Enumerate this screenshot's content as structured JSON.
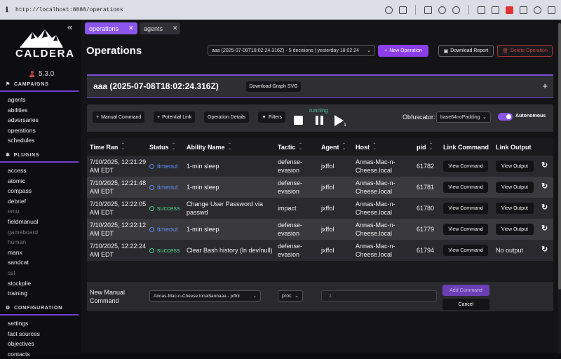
{
  "browser": {
    "url": "http://localhost:8888/operations"
  },
  "sidebar": {
    "brand": "CALDERA",
    "version": "5.3.0",
    "campaigns_header": "CAMPAIGNS",
    "campaigns": [
      "agents",
      "abilities",
      "adversaries",
      "operations",
      "schedules"
    ],
    "plugins_header": "PLUGINS",
    "plugins": [
      {
        "label": "access",
        "enabled": true
      },
      {
        "label": "atomic",
        "enabled": true
      },
      {
        "label": "compass",
        "enabled": true
      },
      {
        "label": "debrief",
        "enabled": true
      },
      {
        "label": "emu",
        "enabled": false
      },
      {
        "label": "fieldmanual",
        "enabled": true
      },
      {
        "label": "gameboard",
        "enabled": false
      },
      {
        "label": "human",
        "enabled": false
      },
      {
        "label": "manx",
        "enabled": true
      },
      {
        "label": "sandcat",
        "enabled": true
      },
      {
        "label": "ssl",
        "enabled": false
      },
      {
        "label": "stockpile",
        "enabled": true
      },
      {
        "label": "training",
        "enabled": true
      }
    ],
    "configuration_header": "CONFIGURATION",
    "configuration": [
      "settings",
      "fact sources",
      "objectives",
      "contacts"
    ]
  },
  "tabs": [
    {
      "label": "operations",
      "active": true
    },
    {
      "label": "agents",
      "active": false
    }
  ],
  "page": {
    "title": "Operations",
    "operation_select": "aaa (2025-07-08T18:02:24.316Z) - 5 decisions | yesterday 18:02:24",
    "new_operation": "New Operation",
    "download_report": "Download Report",
    "delete_operation": "Delete Operation"
  },
  "banner": {
    "title": "aaa (2025-07-08T18:02:24.316Z)",
    "download_graph": "Download Graph SVG"
  },
  "toolbar": {
    "manual_command": "Manual Command",
    "potential_link": "Potential Link",
    "operation_details": "Operation Details",
    "filters": "Filters",
    "state": "running",
    "play_badge": "1",
    "obfuscator_label": "Obfuscator:",
    "obfuscator_value": "base64noPadding",
    "autonomous_label": "Autonomous"
  },
  "table": {
    "headers": [
      "Time Ran",
      "Status",
      "Ability Name",
      "Tactic",
      "Agent",
      "Host",
      "pid",
      "Link Command",
      "Link Output"
    ],
    "rows": [
      {
        "time1": "7/10/2025, 12:21:29",
        "time2": "AM EDT",
        "status": "timeout",
        "ability1": "1-min sleep",
        "ability2": "",
        "tactic1": "defense-",
        "tactic2": "evasion",
        "agent": "jxffol",
        "host1": "Annas-Mac-n-",
        "host2": "Cheese.local",
        "pid": "61782",
        "cmd": "View Command",
        "output": "View Output"
      },
      {
        "time1": "7/10/2025, 12:21:48",
        "time2": "AM EDT",
        "status": "timeout",
        "ability1": "1-min sleep",
        "ability2": "",
        "tactic1": "defense-",
        "tactic2": "evasion",
        "agent": "jxffol",
        "host1": "Annas-Mac-n-",
        "host2": "Cheese.local",
        "pid": "61781",
        "cmd": "View Command",
        "output": "View Output"
      },
      {
        "time1": "7/10/2025, 12:22:05",
        "time2": "AM EDT",
        "status": "success",
        "ability1": "Change User Password via",
        "ability2": "passwd",
        "tactic1": "impact",
        "tactic2": "",
        "agent": "jxffol",
        "host1": "Annas-Mac-n-",
        "host2": "Cheese.local",
        "pid": "61780",
        "cmd": "View Command",
        "output": "View Output"
      },
      {
        "time1": "7/10/2025, 12:22:12",
        "time2": "AM EDT",
        "status": "timeout",
        "ability1": "1-min sleep",
        "ability2": "",
        "tactic1": "defense-",
        "tactic2": "evasion",
        "agent": "jxffol",
        "host1": "Annas-Mac-n-",
        "host2": "Cheese.local",
        "pid": "61779",
        "cmd": "View Command",
        "output": "View Output"
      },
      {
        "time1": "7/10/2025, 12:22:24",
        "time2": "AM EDT",
        "status": "success",
        "ability1": "Clear Bash history (ln dev/null)",
        "ability2": "",
        "tactic1": "defense-",
        "tactic2": "evasion",
        "agent": "jxffol",
        "host1": "Annas-Mac-n-",
        "host2": "Cheese.local",
        "pid": "61794",
        "cmd": "View Command",
        "output": "No output"
      }
    ],
    "new_manual_label1": "New Manual",
    "new_manual_label2": "Command",
    "agent_select": "Annas-Mac-n-Cheese.local$annaaa - jxffol",
    "executor_select": "proc",
    "command_placeholder": "1",
    "add_command": "Add Command",
    "cancel": "Cancel"
  },
  "colors": {
    "accent": "#8b55f0",
    "timeout": "#5b8bf0",
    "success": "#49c98a",
    "danger": "#b44444"
  }
}
